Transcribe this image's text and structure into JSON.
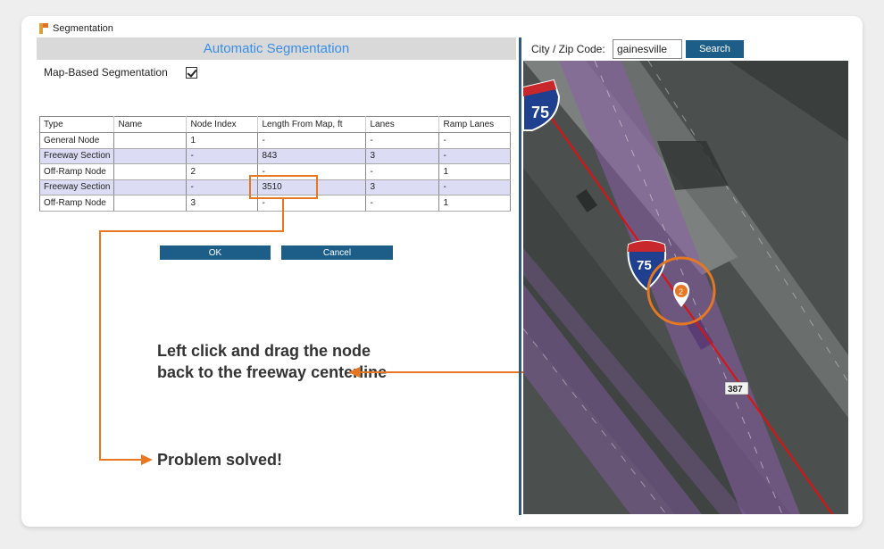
{
  "window": {
    "title": "Segmentation"
  },
  "panel": {
    "header": "Automatic Segmentation",
    "map_based_label": "Map-Based Segmentation",
    "map_based_checked": true
  },
  "table": {
    "headers": [
      "Type",
      "Name",
      "Node Index",
      "Length From Map, ft",
      "Lanes",
      "Ramp Lanes"
    ],
    "rows": [
      [
        "General Node",
        "",
        "1",
        "-",
        "-",
        "-"
      ],
      [
        "Freeway Section",
        "",
        "-",
        "843",
        "3",
        "-"
      ],
      [
        "Off-Ramp Node",
        "",
        "2",
        "-",
        "-",
        "1"
      ],
      [
        "Freeway Section",
        "",
        "-",
        "3510",
        "3",
        "-"
      ],
      [
        "Off-Ramp Node",
        "",
        "3",
        "-",
        "-",
        "1"
      ]
    ]
  },
  "buttons": {
    "ok": "OK",
    "cancel": "Cancel",
    "search": "Search"
  },
  "search": {
    "label": "City / Zip Code:",
    "value": "gainesville"
  },
  "map": {
    "shield_number": "75",
    "route_number": "387",
    "node_marker": "2"
  },
  "annotations": {
    "drag_note": "Left click and drag the node back to the freeway centerline",
    "solved_note": "Problem solved!"
  },
  "colors": {
    "accent_orange": "#e87722",
    "button_blue": "#1c5e87",
    "header_text": "#3a8ee6",
    "centerline_red": "#e01010",
    "lane_purple": "#8a5ea8"
  }
}
